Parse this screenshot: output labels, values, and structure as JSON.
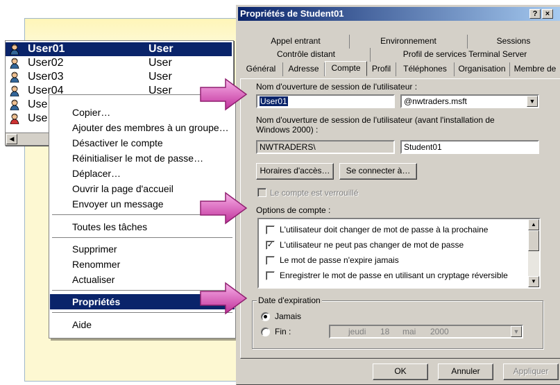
{
  "user_list": {
    "rows": [
      {
        "name": "User01",
        "type": "User",
        "selected": true
      },
      {
        "name": "User02",
        "type": "User"
      },
      {
        "name": "User03",
        "type": "User"
      },
      {
        "name": "User04",
        "type": "User"
      },
      {
        "name": "Use",
        "type": ""
      },
      {
        "name": "Use",
        "type": ""
      }
    ],
    "scroll_left_icon": "triangle-left"
  },
  "context_menu": {
    "items": [
      "Copier…",
      "Ajouter des membres à un groupe…",
      "Désactiver le compte",
      "Réinitialiser le mot de passe…",
      "Déplacer…",
      "Ouvrir la page d'accueil",
      "Envoyer un message",
      "Toutes les tâches",
      "Supprimer",
      "Renommer",
      "Actualiser",
      "Propriétés",
      "Aide"
    ],
    "highlighted": "Propriétés"
  },
  "dialog": {
    "title": "Propriétés de Student01",
    "help_btn": "?",
    "close_btn": "×",
    "tabs_row1": [
      "Appel entrant",
      "Environnement",
      "Sessions"
    ],
    "tabs_row2": [
      "Contrôle distant",
      "Profil de services Terminal Server"
    ],
    "tabs_row3": [
      "Général",
      "Adresse",
      "Compte",
      "Profil",
      "Téléphones",
      "Organisation",
      "Membre de"
    ],
    "active_tab": "Compte",
    "logon_label": "Nom d'ouverture de session de l'utilisateur :",
    "logon_value": "User01",
    "domain_value": "@nwtraders.msft",
    "pre2000_label_line1": "Nom d'ouverture de session de l'utilisateur (avant l'installation de",
    "pre2000_label_line2": "Windows 2000) :",
    "pre2000_domain": "NWTRADERS\\",
    "pre2000_user": "Student01",
    "logon_hours_btn": "Horaires d'accès…",
    "logon_to_btn": "Se connecter à…",
    "locked_label": "Le compte est verrouillé",
    "options_label": "Options de compte :",
    "options": [
      {
        "label": "L'utilisateur doit changer de mot de passe à la prochaine",
        "checked": false
      },
      {
        "label": "L'utilisateur ne peut pas changer de mot de passe",
        "checked": true
      },
      {
        "label": "Le mot de passe n'expire jamais",
        "checked": false
      },
      {
        "label": "Enregistrer le mot de passe en utilisant un cryptage réversible",
        "checked": false
      }
    ],
    "expiry_group": "Date d'expiration",
    "expiry_never": "Jamais",
    "expiry_end": "Fin :",
    "expiry_date": {
      "day_name": "jeudi",
      "day": "18",
      "month": "mai",
      "year": "2000"
    },
    "ok_btn": "OK",
    "cancel_btn": "Annuler",
    "apply_btn": "Appliquer"
  },
  "colors": {
    "selection": "#0a246a",
    "dialog_bg": "#d4d0c8",
    "backdrop": "#fdf8d2",
    "arrow": "#e060c0"
  }
}
